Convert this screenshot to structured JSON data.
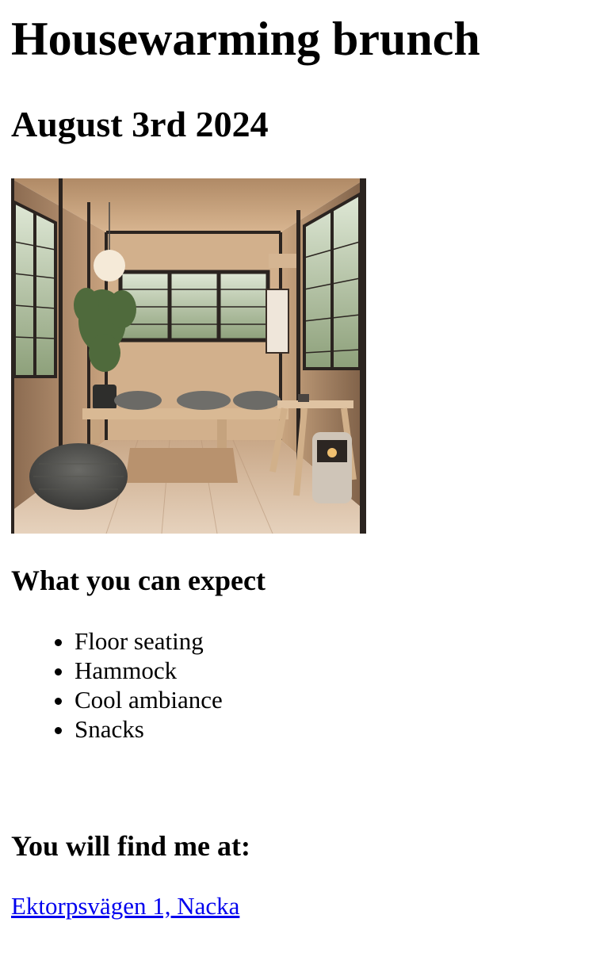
{
  "page": {
    "title": "Housewarming brunch",
    "date": "August 3rd 2024"
  },
  "photo": {
    "description_icon": "room-interior-photo"
  },
  "expect": {
    "heading": "What you can expect",
    "items": [
      {
        "label": "Floor seating"
      },
      {
        "label": "Hammock"
      },
      {
        "label": "Cool ambiance"
      },
      {
        "label": "Snacks"
      }
    ]
  },
  "location": {
    "heading": "You will find me at:",
    "address_link": "Ektorpsvägen 1, Nacka"
  },
  "colors": {
    "link": "#0000ee",
    "text": "#000000",
    "background": "#ffffff"
  }
}
